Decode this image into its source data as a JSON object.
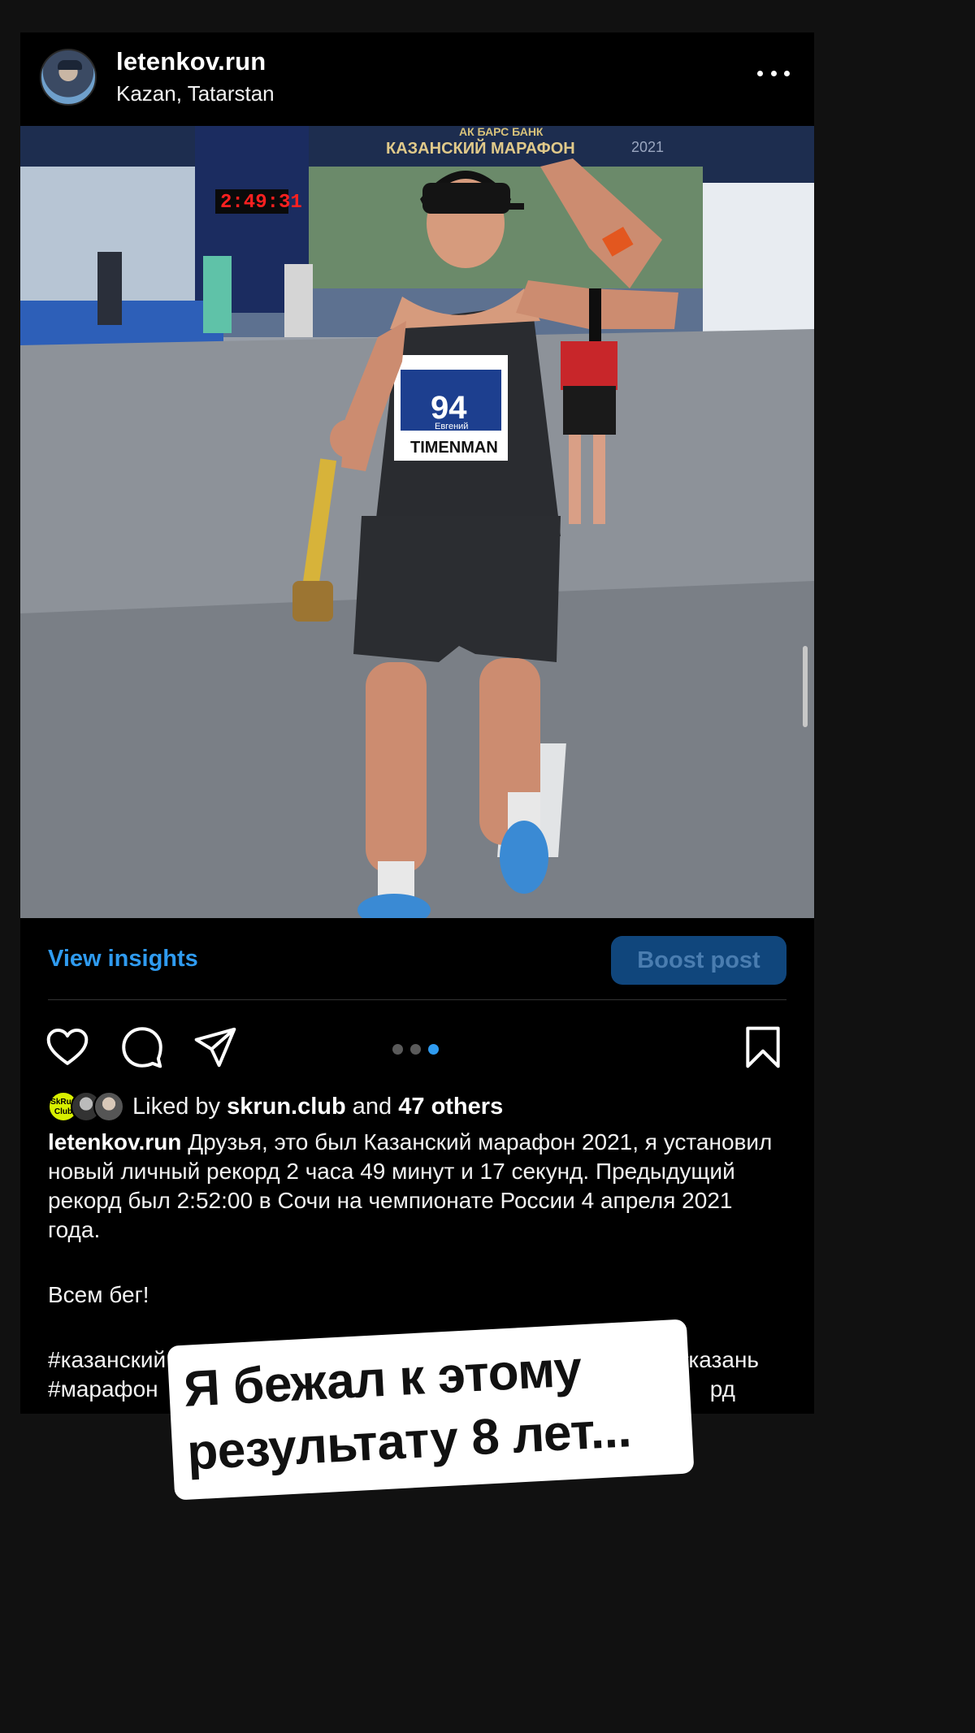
{
  "header": {
    "username": "letenkov.run",
    "location": "Kazan, Tatarstan"
  },
  "photo": {
    "bib_number": "94",
    "bib_name": "Евгений",
    "bib_sponsor": "TIMENMAN",
    "banner_bank": "АК БАРС БАНК",
    "banner_title": "КАЗАНСКИЙ МАРАФОН",
    "banner_year": "2021",
    "clock_text": "2:49:31"
  },
  "insights": {
    "view_label": "View insights",
    "boost_label": "Boost post"
  },
  "carousel": {
    "total": 3,
    "active_index": 2
  },
  "likes": {
    "prefix": "Liked by",
    "user": "skrun.club",
    "and": "and",
    "others": "47 others",
    "avatar1_text": "SkRun Club"
  },
  "caption": {
    "username": "letenkov.run",
    "text": "Друзья, это был Казанский марафон 2021, я установил новый личный рекорд 2 часа 49 минут и 17 секунд. Предыдущий рекорд был 2:52:00 в Сочи на чемпионате России 4 апреля 2021 года.",
    "line2": "Всем бег!",
    "hashtags_line1": "#казанский",
    "hashtags_line1_end": "#казань",
    "hashtags_line2": "#марафон",
    "hashtags_line2_end": "рд"
  },
  "sticker": {
    "line1": "Я бежал к этому",
    "line2": "результату 8 лет..."
  },
  "colors": {
    "background": "#111111",
    "accent": "#2f9bf0",
    "boost_button": "#10467c"
  }
}
